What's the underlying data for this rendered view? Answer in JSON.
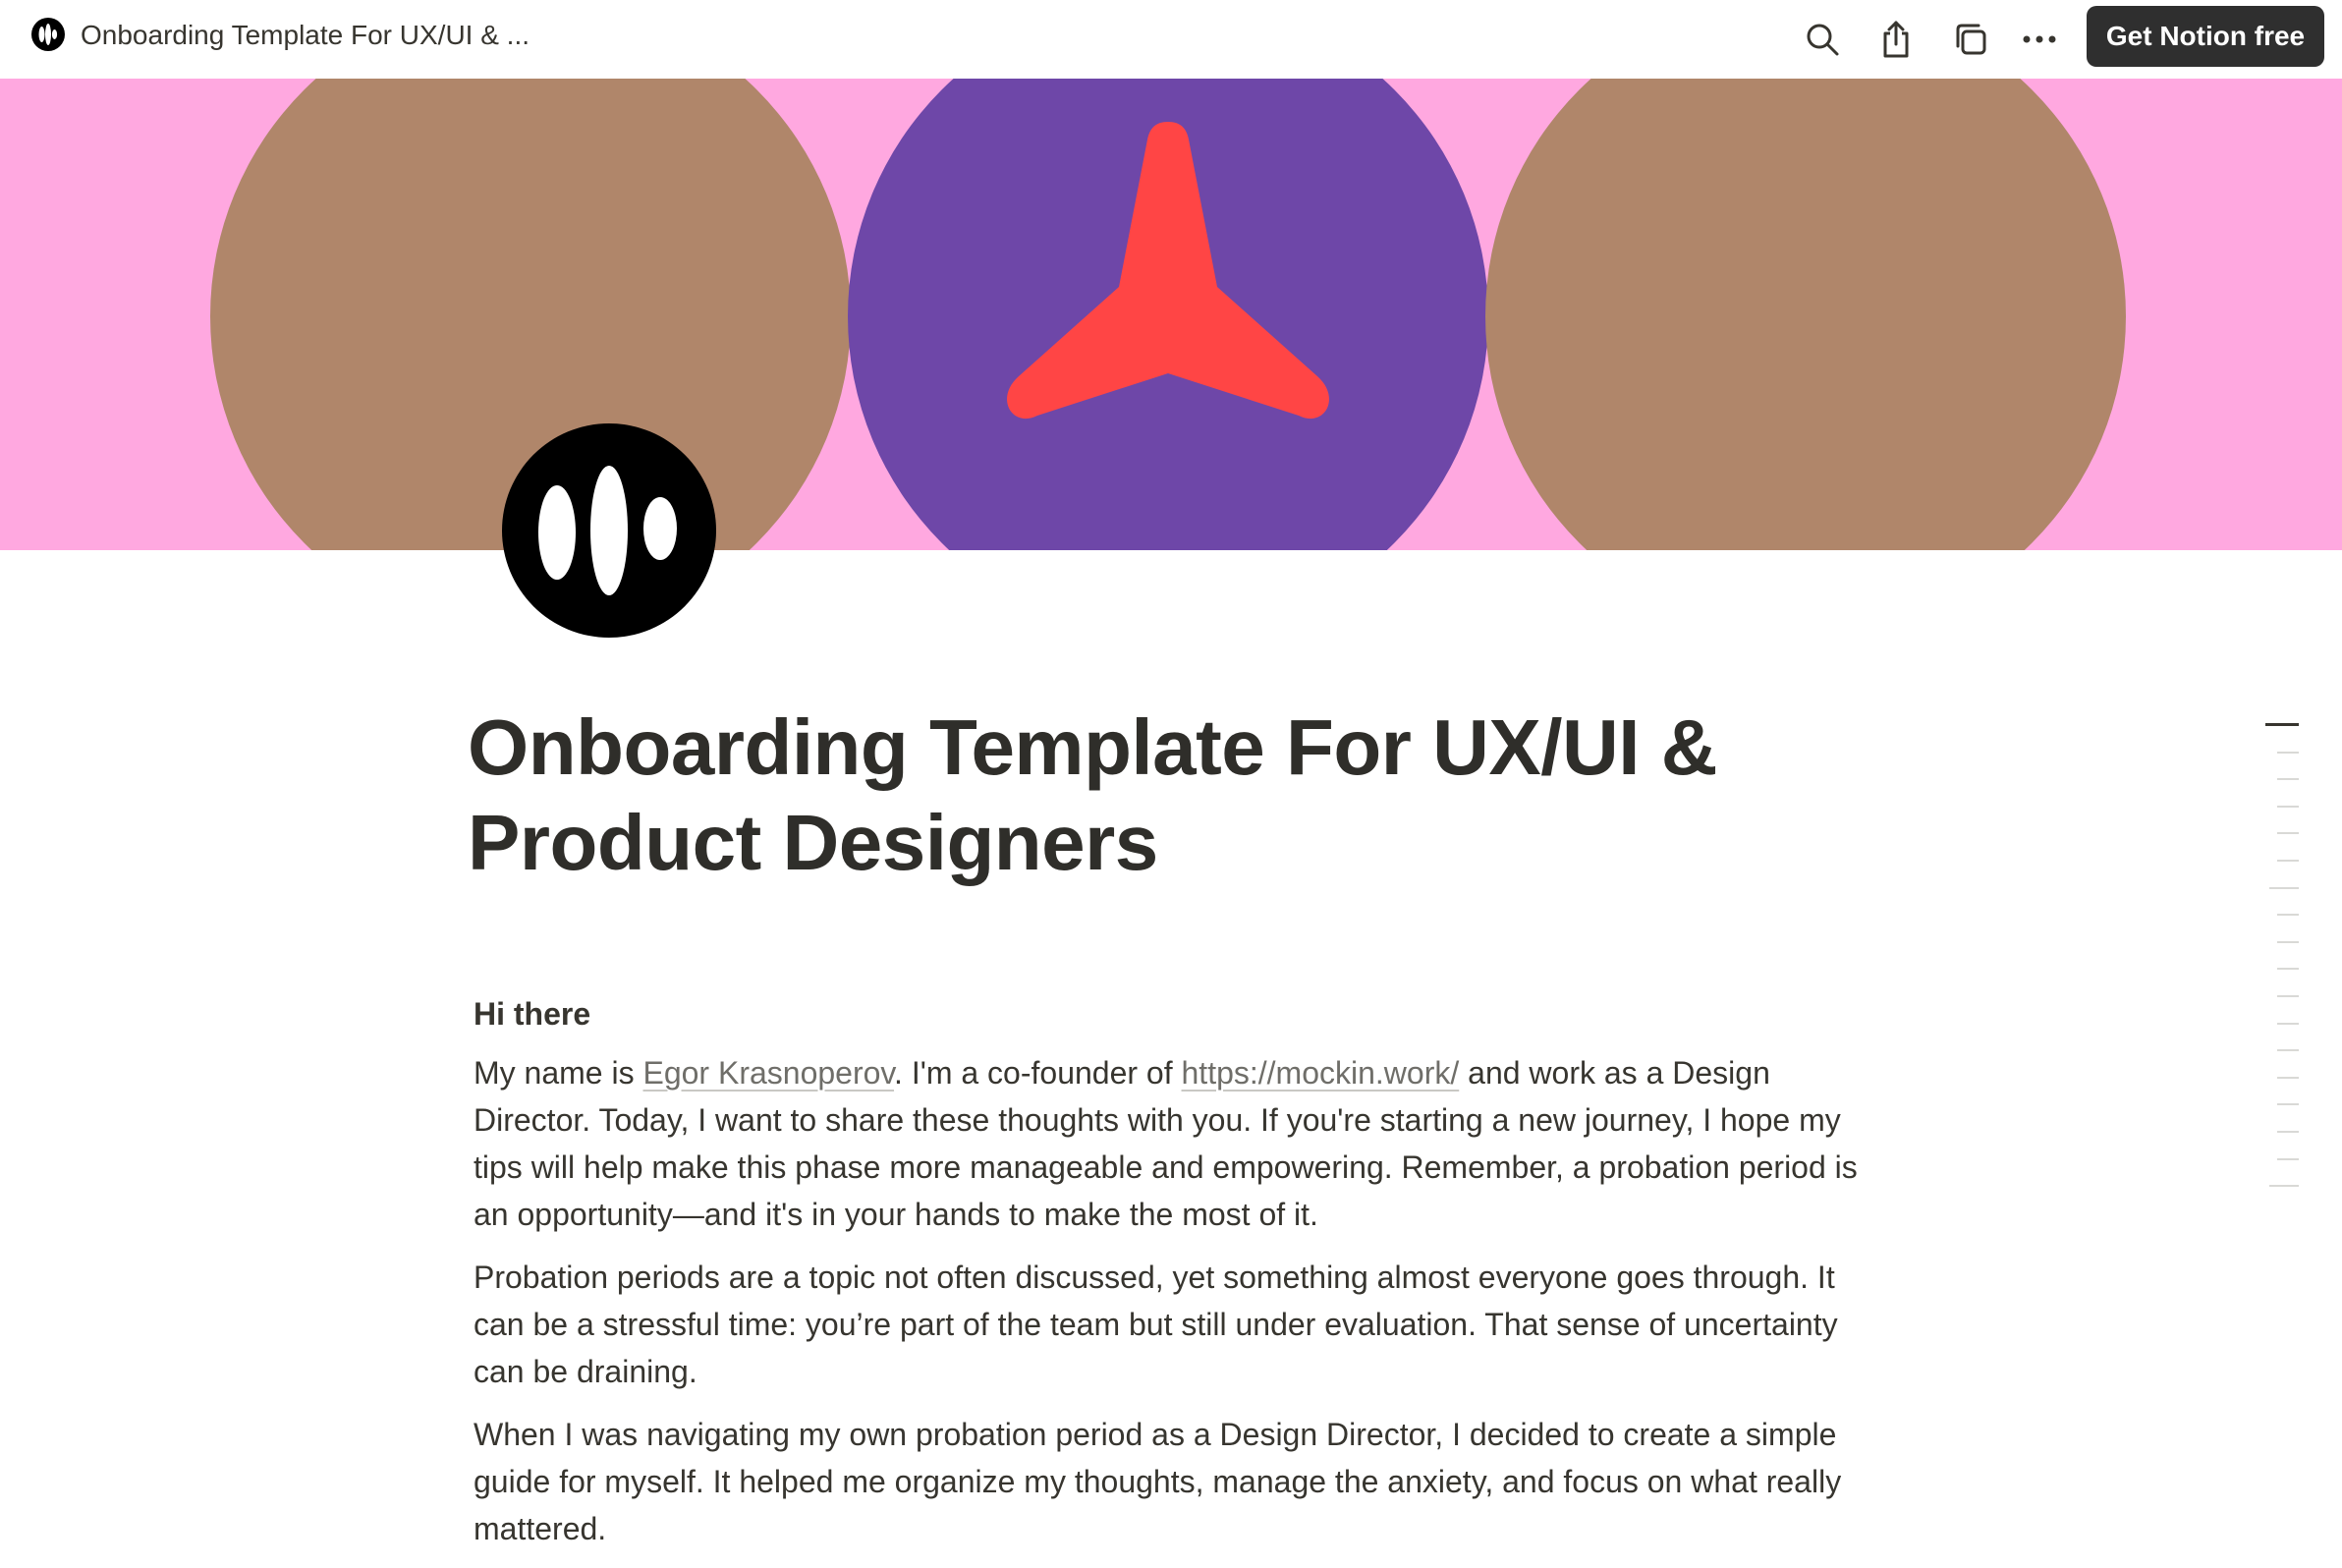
{
  "topbar": {
    "title": "Onboarding Template For UX/UI & ...",
    "page_icon": "notion-site-logo-icon",
    "actions": [
      {
        "name": "search",
        "icon": "search-icon"
      },
      {
        "name": "share",
        "icon": "share-icon"
      },
      {
        "name": "duplicate",
        "icon": "duplicate-icon"
      },
      {
        "name": "more",
        "icon": "more-horizontal-icon"
      }
    ],
    "cta_label": "Get Notion free"
  },
  "cover": {
    "background": "#ffa8e0",
    "circle_left_color": "#b0866a",
    "circle_center_color": "#6e47a8",
    "circle_right_color": "#b0866a",
    "star_color": "#ff4545"
  },
  "page": {
    "icon": "logo-bars-icon",
    "title": "Onboarding Template For UX/UI & Product Designers"
  },
  "body": {
    "greeting": "Hi there",
    "intro": {
      "t1": "My name is ",
      "link1": "Egor Krasnoperov",
      "t2": ". I'm a co-founder of ",
      "link2": "https://mockin.work/",
      "t3": " and work as a Design Director. Today, I want to share these thoughts with you. If you're starting a new journey, I hope my tips will help make this phase more manageable and empowering. Remember, a probation period is an opportunity—and it's in your hands to make the most of it."
    },
    "p2": "Probation periods are a topic not often discussed, yet something almost everyone goes through. It can be a stressful time: you’re part of the team but still under evaluation. That sense of uncertainty can be draining.",
    "p3": "When I was navigating my own probation period as a Design Director, I decided to create a simple guide for myself. It helped me organize my thoughts, manage the anxiety, and focus on what really mattered."
  },
  "toc": {
    "items": 18,
    "active_index": 0
  }
}
